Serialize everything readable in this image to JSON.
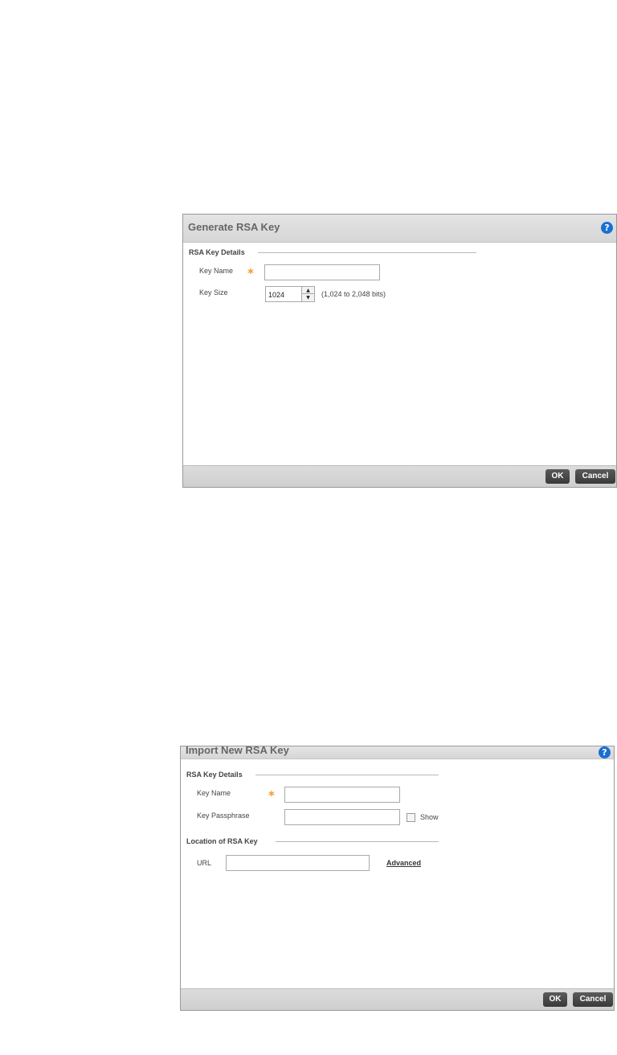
{
  "generate_dialog": {
    "title": "Generate RSA Key",
    "help_icon": "?",
    "section": "RSA Key Details",
    "key_name_label": "Key Name",
    "key_name_value": "",
    "key_size_label": "Key Size",
    "key_size_value": "1024",
    "key_size_hint": "(1,024 to 2,048 bits)",
    "ok_label": "OK",
    "cancel_label": "Cancel"
  },
  "import_dialog": {
    "title": "Import New RSA Key",
    "help_icon": "?",
    "section_details": "RSA Key Details",
    "key_name_label": "Key Name",
    "key_name_value": "",
    "passphrase_label": "Key Passphrase",
    "passphrase_value": "",
    "show_label": "Show",
    "section_location": "Location of RSA Key",
    "url_label": "URL",
    "url_value": "",
    "advanced_link": "Advanced",
    "ok_label": "OK",
    "cancel_label": "Cancel"
  },
  "icons": {
    "required": "*",
    "spin_up": "▲",
    "spin_down": "▼"
  },
  "colors": {
    "help_icon": "#1a6fd1",
    "required_star": "#f39a2a",
    "button_bg": "#444444"
  }
}
